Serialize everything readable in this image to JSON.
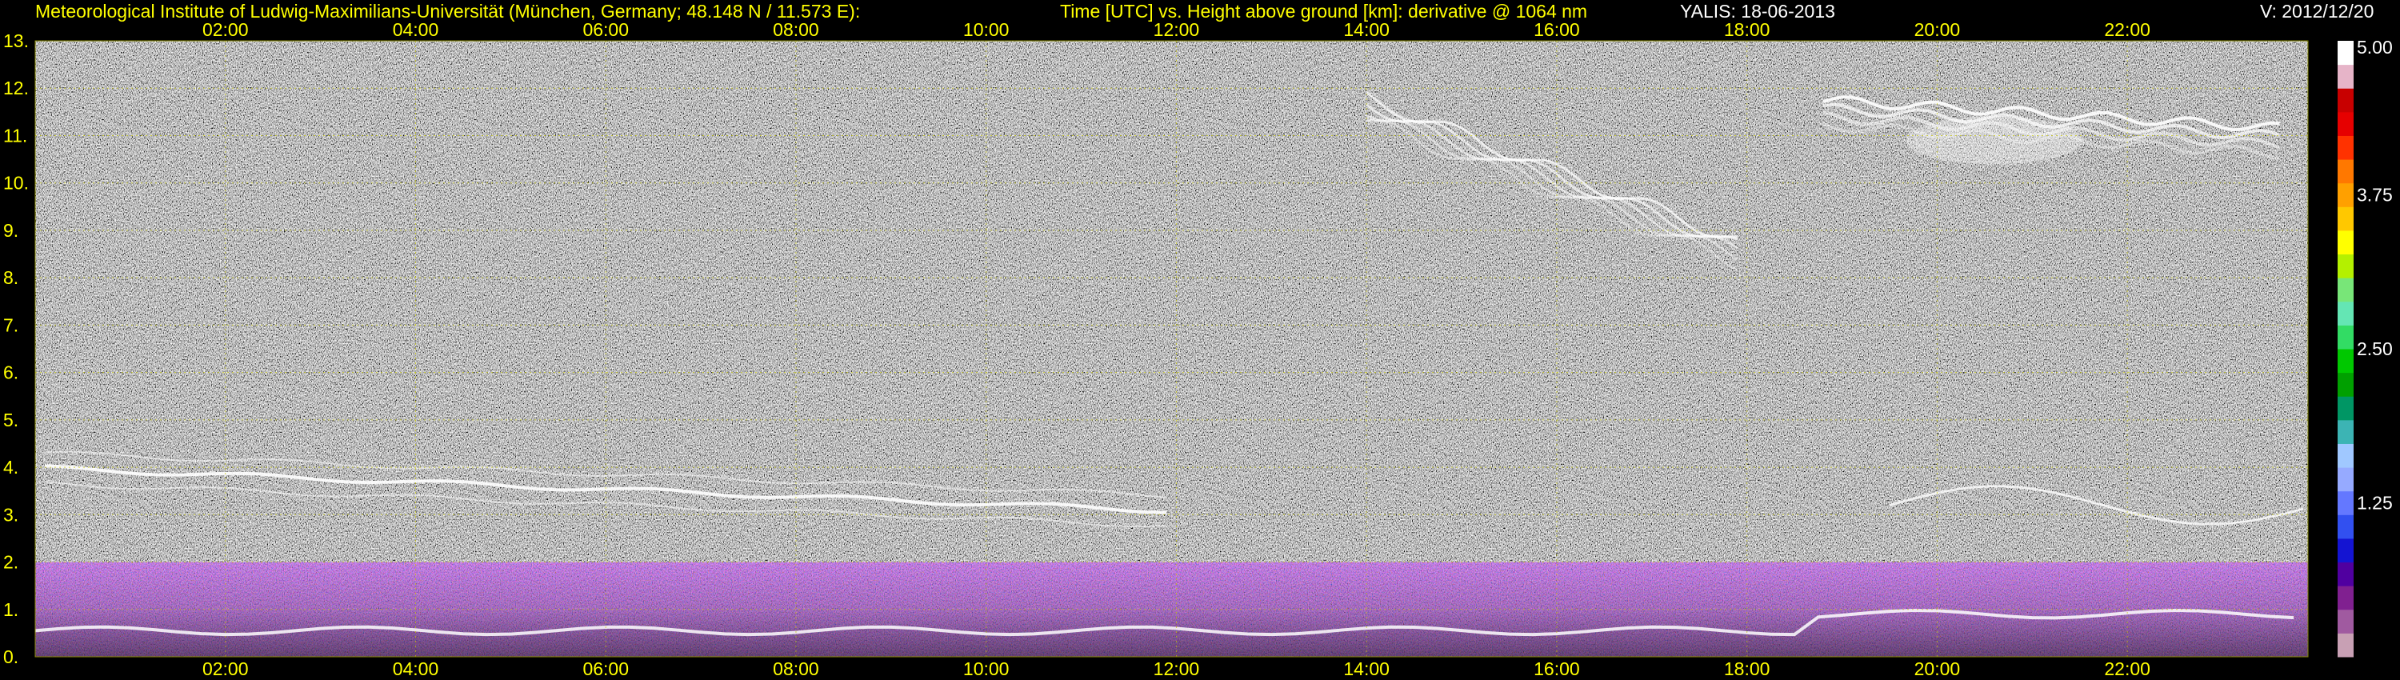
{
  "header": {
    "institute": "Meteorological Institute of Ludwig-Maximilians-Universität (München, Germany; 48.148 N / 11.573 E):",
    "plot_title": "Time [UTC] vs. Height above ground [km]: derivative @ 1064 nm",
    "instrument": "YALIS: 18-06-2013",
    "version": "V: 2012/12/20"
  },
  "colors": {
    "background": "#000000",
    "axis_text": "#ffff00",
    "grid": "#c8c800",
    "noise_gray": "#7a7a7a"
  },
  "chart_data": {
    "type": "heatmap",
    "x_tick_labels": [
      "02:00",
      "04:00",
      "06:00",
      "08:00",
      "10:00",
      "12:00",
      "14:00",
      "16:00",
      "18:00",
      "20:00",
      "22:00"
    ],
    "x_tick_hours": [
      2,
      4,
      6,
      8,
      10,
      12,
      14,
      16,
      18,
      20,
      22
    ],
    "xlim_hours": [
      0.0,
      23.9
    ],
    "y_tick_labels": [
      "0.",
      "1.",
      "2.",
      "3.",
      "4.",
      "5.",
      "6.",
      "7.",
      "8.",
      "9.",
      "10.",
      "11.",
      "12.",
      "13."
    ],
    "y_tick_values": [
      0,
      1,
      2,
      3,
      4,
      5,
      6,
      7,
      8,
      9,
      10,
      11,
      12,
      13
    ],
    "ylim_km": [
      0,
      13
    ],
    "grid": true,
    "colorbar": {
      "labels": [
        "5.00",
        "3.75",
        "2.50",
        "1.25"
      ],
      "values": [
        5.0,
        3.75,
        2.5,
        1.25
      ],
      "range": [
        0,
        5
      ],
      "colors": [
        "#c8a0b4",
        "#a05aa0",
        "#802090",
        "#5000a0",
        "#1414d2",
        "#3250f0",
        "#6478ff",
        "#96aaff",
        "#a0c8ff",
        "#3cb4b4",
        "#009664",
        "#00a000",
        "#00c800",
        "#32dc64",
        "#64e6b4",
        "#78e678",
        "#b4f000",
        "#ffff00",
        "#ffc800",
        "#ffa000",
        "#ff7800",
        "#ff3200",
        "#e60000",
        "#c80000",
        "#e6b4c8",
        "#ffffff"
      ]
    },
    "features": [
      {
        "name": "aerosol layer top",
        "t_start": 0.1,
        "t_end": 23.9,
        "h_start": 4.3,
        "h_end": 3.2
      },
      {
        "name": "boundary layer",
        "t_start": 0.0,
        "t_end": 23.9,
        "h_start": 0.3,
        "h_end": 2.0
      },
      {
        "name": "cirrus 14-18h",
        "t_start": 14.0,
        "t_end": 18.4,
        "h_start": 11.8,
        "h_end": 8.4
      },
      {
        "name": "cirrus 19-23h",
        "t_start": 18.8,
        "t_end": 23.7,
        "h_start": 11.2,
        "h_end": 12.3
      }
    ]
  }
}
